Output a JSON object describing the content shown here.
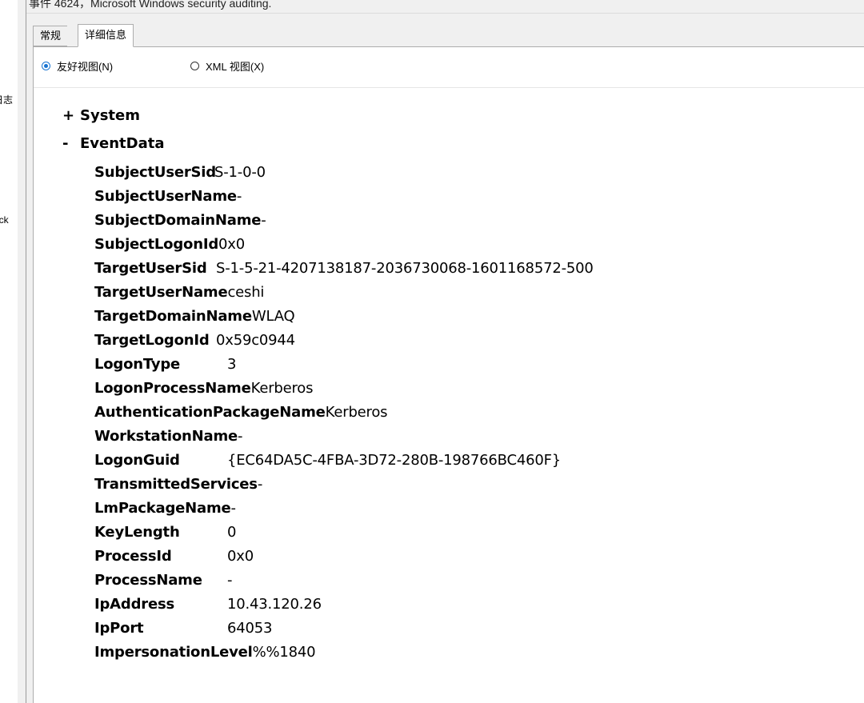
{
  "title": "事件 4624，Microsoft Windows security auditing.",
  "left_fragments": [
    "日志",
    "ack"
  ],
  "tabs": [
    {
      "label": "常规",
      "active": false
    },
    {
      "label": "详细信息",
      "active": true
    }
  ],
  "view_options": {
    "friendly": {
      "label": "友好视图(N)",
      "checked": true
    },
    "xml": {
      "label": "XML 视图(X)",
      "checked": false
    }
  },
  "sections": {
    "system": {
      "toggle": "+",
      "label": "System"
    },
    "eventdata": {
      "toggle": "-",
      "label": "EventData"
    }
  },
  "event_data": [
    {
      "key": "SubjectUserSid",
      "value": "S-1-0-0"
    },
    {
      "key": "SubjectUserName",
      "value": "-"
    },
    {
      "key": "SubjectDomainName",
      "value": "-"
    },
    {
      "key": "SubjectLogonId",
      "value": "0x0"
    },
    {
      "key": "TargetUserSid",
      "value": "S-1-5-21-4207138187-2036730068-1601168572-500"
    },
    {
      "key": "TargetUserName",
      "value": "ceshi"
    },
    {
      "key": "TargetDomainName",
      "value": "WLAQ"
    },
    {
      "key": "TargetLogonId",
      "value": "0x59c0944"
    },
    {
      "key": "LogonType",
      "value": "3"
    },
    {
      "key": "LogonProcessName",
      "value": "Kerberos"
    },
    {
      "key": "AuthenticationPackageName",
      "value": "Kerberos"
    },
    {
      "key": "WorkstationName",
      "value": "-"
    },
    {
      "key": "LogonGuid",
      "value": "{EC64DA5C-4FBA-3D72-280B-198766BC460F}"
    },
    {
      "key": "TransmittedServices",
      "value": "-"
    },
    {
      "key": "LmPackageName",
      "value": "-"
    },
    {
      "key": "KeyLength",
      "value": "0"
    },
    {
      "key": "ProcessId",
      "value": "0x0"
    },
    {
      "key": "ProcessName",
      "value": "-"
    },
    {
      "key": "IpAddress",
      "value": "10.43.120.26"
    },
    {
      "key": "IpPort",
      "value": "64053"
    },
    {
      "key": "ImpersonationLevel",
      "value": "%%1840"
    }
  ]
}
